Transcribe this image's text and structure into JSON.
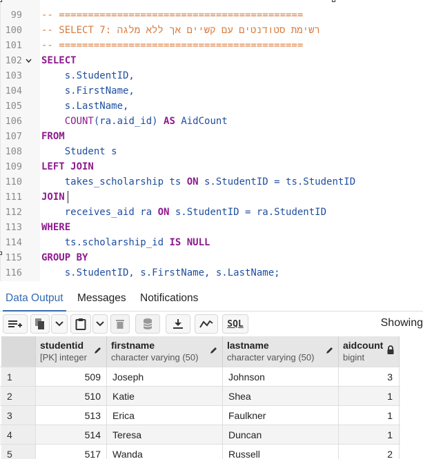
{
  "editor": {
    "lines": [
      {
        "num": "99",
        "tokens": [
          {
            "t": "-- ==========================================",
            "c": "cm"
          }
        ]
      },
      {
        "num": "100",
        "tokens": [
          {
            "t": "-- SELECT 7: רשימת סטודנטים עם קשיים אך ללא מלגה",
            "c": "cm"
          }
        ]
      },
      {
        "num": "101",
        "tokens": [
          {
            "t": "-- ==========================================",
            "c": "cm"
          }
        ]
      },
      {
        "num": "102",
        "fold": true,
        "tokens": [
          {
            "t": "SELECT",
            "c": "kw"
          }
        ]
      },
      {
        "num": "103",
        "tokens": [
          {
            "t": "    s.StudentID,",
            "c": "ident"
          }
        ]
      },
      {
        "num": "104",
        "tokens": [
          {
            "t": "    s.FirstName,",
            "c": "ident"
          }
        ]
      },
      {
        "num": "105",
        "tokens": [
          {
            "t": "    s.LastName,",
            "c": "ident"
          }
        ]
      },
      {
        "num": "106",
        "tokens": [
          {
            "t": "    ",
            "c": "ident"
          },
          {
            "t": "COUNT",
            "c": "fn"
          },
          {
            "t": "(ra.aid_id) ",
            "c": "ident"
          },
          {
            "t": "AS",
            "c": "kw"
          },
          {
            "t": " AidCount",
            "c": "ident"
          }
        ]
      },
      {
        "num": "107",
        "tokens": [
          {
            "t": "FROM",
            "c": "kw"
          }
        ]
      },
      {
        "num": "108",
        "tokens": [
          {
            "t": "    Student s",
            "c": "ident"
          }
        ]
      },
      {
        "num": "109",
        "tokens": [
          {
            "t": "LEFT JOIN",
            "c": "kw"
          }
        ]
      },
      {
        "num": "110",
        "tokens": [
          {
            "t": "    takes_scholarship ts ",
            "c": "ident"
          },
          {
            "t": "ON",
            "c": "kw"
          },
          {
            "t": " s.StudentID = ts.StudentID",
            "c": "ident"
          }
        ]
      },
      {
        "num": "111",
        "cursor": true,
        "tokens": [
          {
            "t": "JOIN",
            "c": "kw"
          }
        ]
      },
      {
        "num": "112",
        "tokens": [
          {
            "t": "    receives_aid ra ",
            "c": "ident"
          },
          {
            "t": "ON",
            "c": "kw"
          },
          {
            "t": " s.StudentID = ra.StudentID",
            "c": "ident"
          }
        ]
      },
      {
        "num": "113",
        "tokens": [
          {
            "t": "WHERE",
            "c": "kw"
          }
        ]
      },
      {
        "num": "114",
        "tokens": [
          {
            "t": "    ts.scholarship_id ",
            "c": "ident"
          },
          {
            "t": "IS NULL",
            "c": "kw"
          }
        ]
      },
      {
        "num": "115",
        "tokens": [
          {
            "t": "GROUP BY",
            "c": "kw"
          }
        ]
      },
      {
        "num": "116",
        "tokens": [
          {
            "t": "    s.StudentID, s.FirstName, s.LastName;",
            "c": "ident"
          }
        ]
      }
    ]
  },
  "tabs": [
    {
      "label": "Data Output",
      "active": true
    },
    {
      "label": "Messages",
      "active": false
    },
    {
      "label": "Notifications",
      "active": false
    }
  ],
  "toolbar": {
    "icons": [
      "add-row-icon",
      "copy-icon",
      "chevron-down-icon",
      "paste-icon",
      "chevron-down-icon",
      "delete-icon",
      "save-data-icon",
      "download-icon",
      "graph-icon",
      "sql-icon"
    ],
    "sql_label": "SQL",
    "showing_label": "Showing"
  },
  "grid": {
    "columns": [
      {
        "name": "studentid",
        "type": "[PK] integer",
        "editable": true
      },
      {
        "name": "firstname",
        "type": "character varying (50)",
        "editable": true
      },
      {
        "name": "lastname",
        "type": "character varying (50)",
        "editable": true
      },
      {
        "name": "aidcount",
        "type": "bigint",
        "locked": true
      }
    ],
    "rows": [
      {
        "n": "1",
        "cells": [
          "509",
          "Joseph",
          "Johnson",
          "3"
        ]
      },
      {
        "n": "2",
        "cells": [
          "510",
          "Katie",
          "Shea",
          "1"
        ]
      },
      {
        "n": "3",
        "cells": [
          "513",
          "Erica",
          "Faulkner",
          "1"
        ]
      },
      {
        "n": "4",
        "cells": [
          "514",
          "Teresa",
          "Duncan",
          "1"
        ]
      },
      {
        "n": "5",
        "cells": [
          "517",
          "Wanda",
          "Russell",
          "2"
        ]
      }
    ]
  },
  "colors": {
    "accent": "#326bb0",
    "keyword": "#8e1a8e",
    "identifier": "#1f4ea0",
    "comment": "#d67a3c"
  }
}
